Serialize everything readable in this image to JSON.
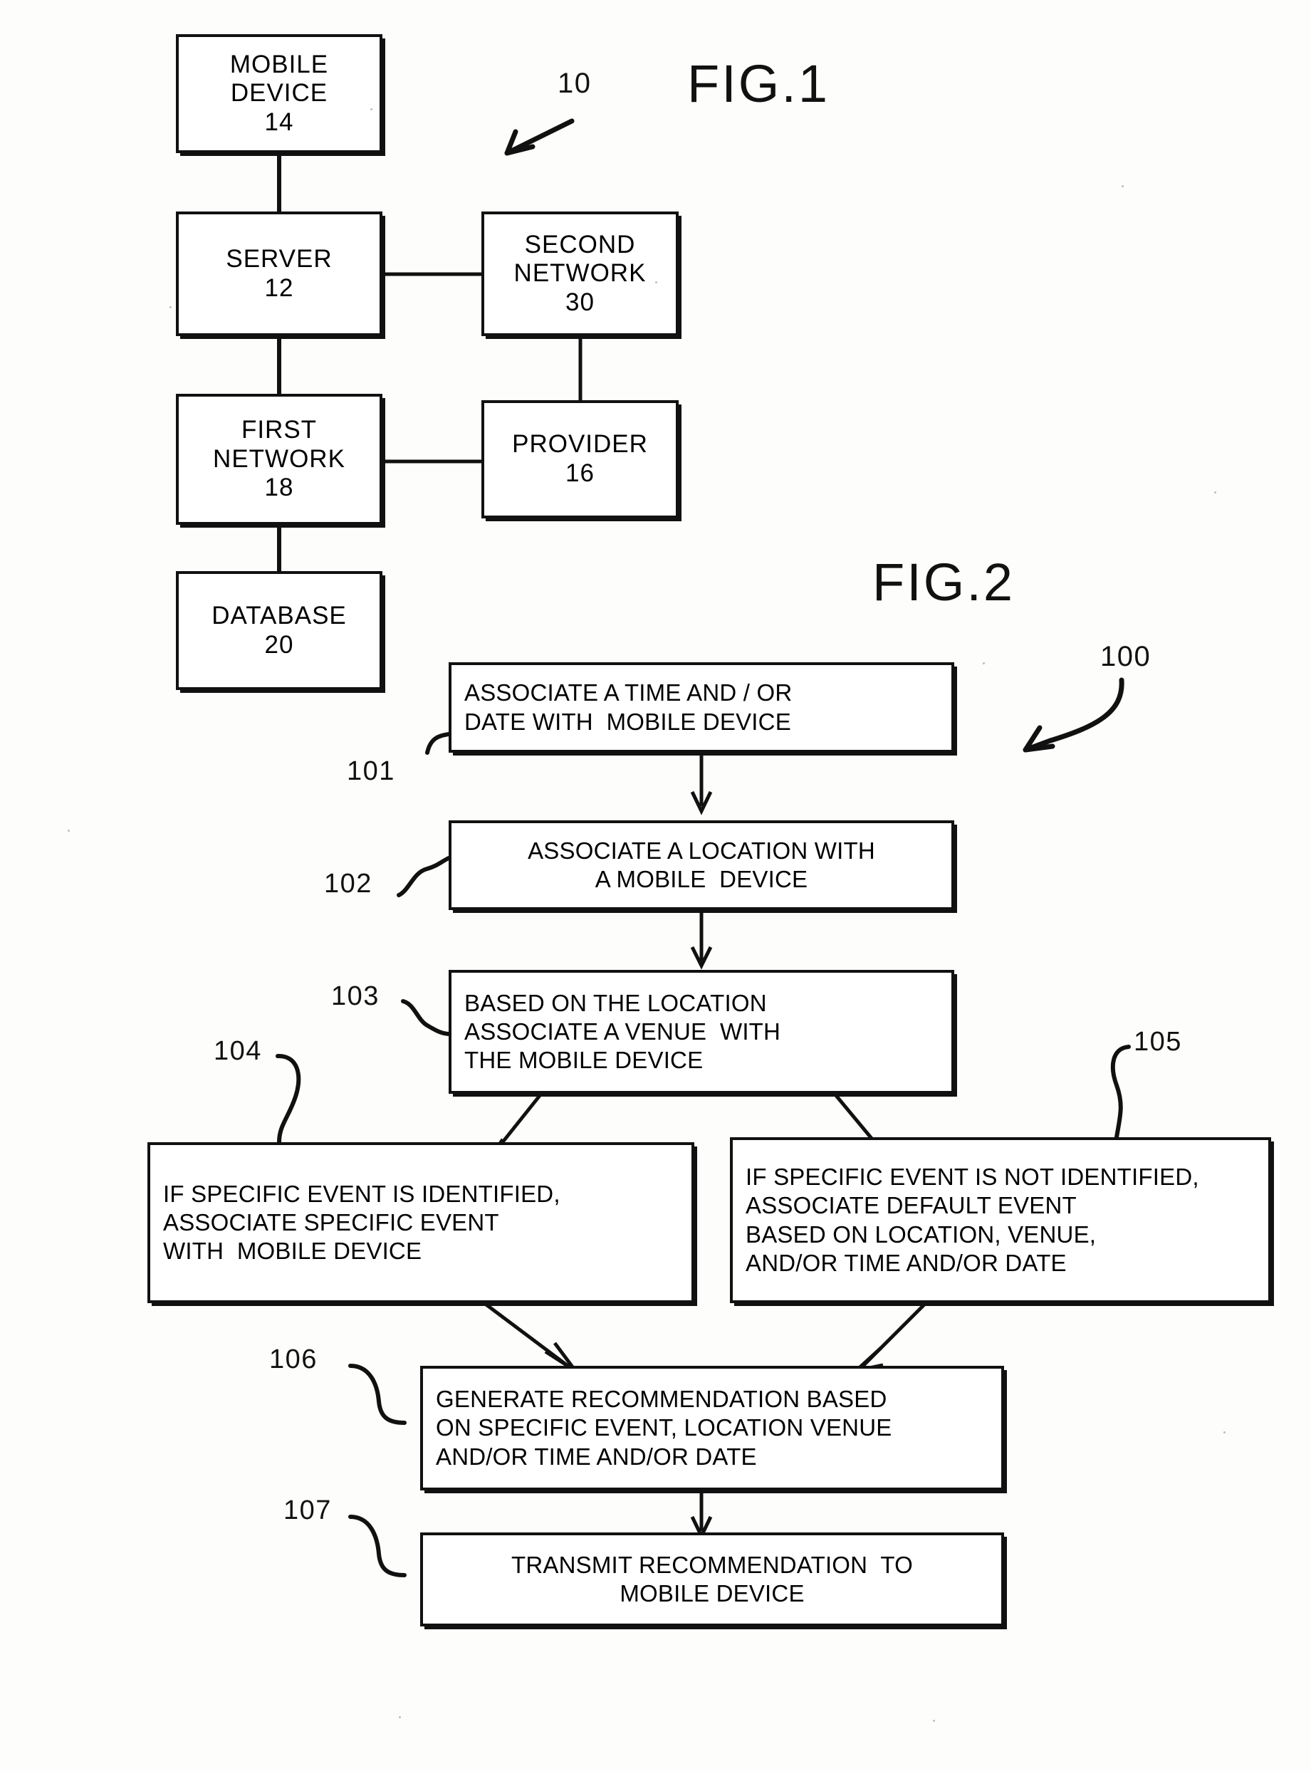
{
  "figures": [
    {
      "id": "fig1",
      "title": "FIG.1",
      "system_ref": "10"
    },
    {
      "id": "fig2",
      "title": "FIG.2",
      "system_ref": "100"
    }
  ],
  "fig1": {
    "title": "FIG.1",
    "system_ref": "10",
    "nodes": [
      {
        "key": "mobile_device",
        "lines": [
          "MOBILE",
          "DEVICE",
          "14"
        ],
        "ref": "14"
      },
      {
        "key": "server",
        "lines": [
          "SERVER",
          "12"
        ],
        "ref": "12"
      },
      {
        "key": "second_network",
        "lines": [
          "SECOND",
          "NETWORK",
          "30"
        ],
        "ref": "30"
      },
      {
        "key": "first_network",
        "lines": [
          "FIRST",
          "NETWORK",
          "18"
        ],
        "ref": "18"
      },
      {
        "key": "provider",
        "lines": [
          "PROVIDER",
          "16"
        ],
        "ref": "16"
      },
      {
        "key": "database",
        "lines": [
          "DATABASE",
          "20"
        ],
        "ref": "20"
      }
    ]
  },
  "fig2": {
    "title": "FIG.2",
    "system_ref": "100",
    "steps": [
      {
        "key": "step101",
        "ref": "101",
        "lines": [
          "ASSOCIATE A TIME AND / OR",
          "DATE WITH  MOBILE DEVICE"
        ]
      },
      {
        "key": "step102",
        "ref": "102",
        "lines": [
          "ASSOCIATE A LOCATION WITH",
          "A MOBILE  DEVICE"
        ]
      },
      {
        "key": "step103",
        "ref": "103",
        "lines": [
          "BASED ON THE LOCATION",
          "ASSOCIATE A VENUE  WITH",
          "THE MOBILE DEVICE"
        ]
      },
      {
        "key": "step104",
        "ref": "104",
        "lines": [
          "IF SPECIFIC EVENT IS IDENTIFIED,",
          "ASSOCIATE SPECIFIC EVENT",
          "WITH  MOBILE DEVICE"
        ]
      },
      {
        "key": "step105",
        "ref": "105",
        "lines": [
          "IF SPECIFIC EVENT IS NOT IDENTIFIED,",
          "ASSOCIATE DEFAULT EVENT",
          "BASED ON LOCATION, VENUE,",
          "AND/OR TIME AND/OR DATE"
        ]
      },
      {
        "key": "step106",
        "ref": "106",
        "lines": [
          "GENERATE RECOMMENDATION BASED",
          "ON SPECIFIC EVENT, LOCATION VENUE",
          "AND/OR TIME AND/OR DATE"
        ]
      },
      {
        "key": "step107",
        "ref": "107",
        "lines": [
          "TRANSMIT RECOMMENDATION  TO",
          "MOBILE DEVICE"
        ]
      }
    ]
  },
  "colors": {
    "ink": "#111111",
    "paper": "#fdfdfb"
  }
}
